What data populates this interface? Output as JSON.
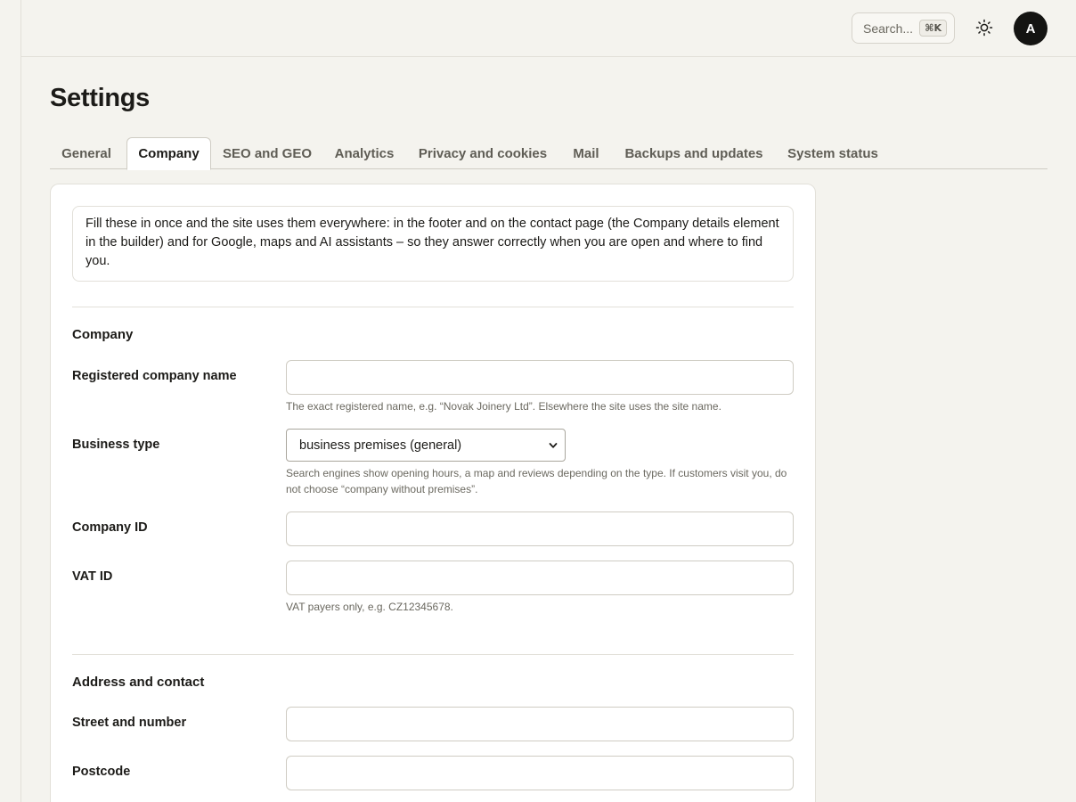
{
  "topbar": {
    "search_label": "Search...",
    "search_shortcut": "⌘K",
    "avatar_initial": "A"
  },
  "page": {
    "title": "Settings"
  },
  "tabs": [
    {
      "label": "General",
      "active": false
    },
    {
      "label": "Company",
      "active": true
    },
    {
      "label": "SEO and GEO",
      "active": false
    },
    {
      "label": "Analytics",
      "active": false
    },
    {
      "label": "Privacy and cookies",
      "active": false
    },
    {
      "label": "Mail",
      "active": false
    },
    {
      "label": "Backups and updates",
      "active": false
    },
    {
      "label": "System status",
      "active": false
    }
  ],
  "intro": "Fill these in once and the site uses them everywhere: in the footer and on the contact page (the Company details element in the builder) and for Google, maps and AI assistants – so they answer correctly when you are open and where to find you.",
  "company_section": {
    "heading": "Company",
    "registered_name": {
      "label": "Registered company name",
      "value": "",
      "help": "The exact registered name, e.g. “Novak Joinery Ltd”. Elsewhere the site uses the site name."
    },
    "business_type": {
      "label": "Business type",
      "selected": "business premises (general)",
      "help": "Search engines show opening hours, a map and reviews depending on the type. If customers visit you, do not choose “company without premises”."
    },
    "company_id": {
      "label": "Company ID",
      "value": ""
    },
    "vat_id": {
      "label": "VAT ID",
      "value": "",
      "help": "VAT payers only, e.g. CZ12345678."
    }
  },
  "address_section": {
    "heading": "Address and contact",
    "street": {
      "label": "Street and number",
      "value": ""
    },
    "postcode": {
      "label": "Postcode",
      "value": ""
    }
  }
}
